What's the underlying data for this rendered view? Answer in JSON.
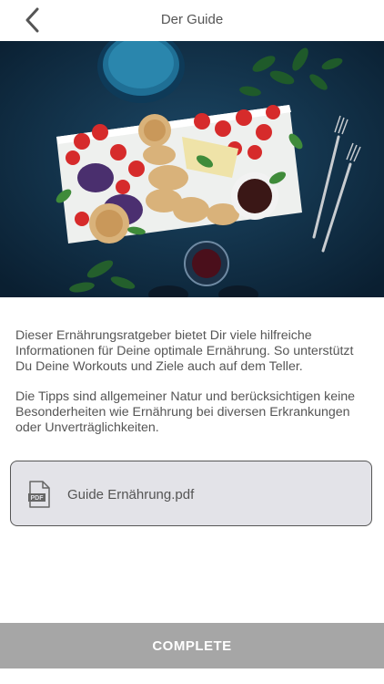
{
  "header": {
    "title": "Der Guide",
    "back_icon": "chevron-left-icon"
  },
  "hero": {
    "image": "food-platter-photo"
  },
  "description": {
    "paragraph_1": "Dieser Ernährungsratgeber bietet Dir viele hilfreiche Informationen für Deine optimale Ernährung. So unterstützt Du Deine Workouts und Ziele auch auf dem Teller.",
    "paragraph_2": "Die Tipps sind allgemeiner Natur und berücksichtigen keine Besonderheiten wie Ernährung bei diversen Erkrankungen oder Unverträglichkeiten."
  },
  "attachment": {
    "icon": "pdf-file-icon",
    "icon_label": "PDF",
    "file_name": "Guide Ernährung.pdf"
  },
  "footer": {
    "complete_label": "COMPLETE"
  },
  "colors": {
    "complete_button_bg": "#a6a6a6",
    "file_card_bg": "#e3e3e8",
    "hero_bg": "#0f2a40"
  }
}
